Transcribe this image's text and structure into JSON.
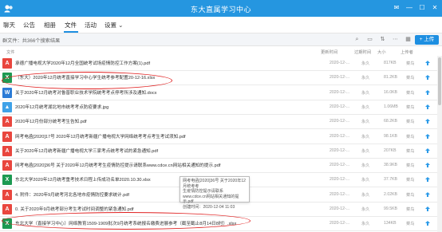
{
  "window": {
    "title": "东大直属学习中心",
    "controls": [
      "✉",
      "—",
      "☐",
      "✕"
    ]
  },
  "tabs": [
    {
      "label": "聊天"
    },
    {
      "label": "公告"
    },
    {
      "label": "相册"
    },
    {
      "label": "文件"
    },
    {
      "label": "活动"
    },
    {
      "label": "设置 ⌄"
    }
  ],
  "toolbar": {
    "breadcrumb": "群文件：共366个搜索结果",
    "upload_label": "+ 上传"
  },
  "columns": {
    "name": "文件",
    "updated": "更新时间",
    "expire": "过期时间",
    "size": "大小",
    "uploader": "上传者"
  },
  "files": [
    {
      "name": "承德广播电视大学2020年12月全国统考试场疫情防控工作方案(1).pdf",
      "type": "pdf",
      "updated": "2020-12-...",
      "expire": "永久",
      "size": "817KB",
      "uploader": "菜鸟"
    },
    {
      "name": "（东大）2020年12月统考直接学习中心学生统考参考配置20-12-16.xlsx",
      "type": "xlsx",
      "updated": "2020-12-...",
      "expire": "永久",
      "size": "81.2KB",
      "uploader": "菜鸟"
    },
    {
      "name": "关于2020年12月统考对鲁普职业技术学院统考考点停考所涉及通知.docx",
      "type": "docx",
      "updated": "2020-12-...",
      "expire": "永久",
      "size": "16.0KB",
      "uploader": "菜鸟"
    },
    {
      "name": "2020年12月统考湖北地市统考考点防疫要求.jpg",
      "type": "jpg",
      "updated": "2020-12-...",
      "expire": "永久",
      "size": "1.06MB",
      "uploader": "菜鸟"
    },
    {
      "name": "2020年12月份部分统考考生告知.pdf",
      "type": "pdf",
      "updated": "2020-12-...",
      "expire": "永久",
      "size": "68.2KB",
      "uploader": "菜鸟"
    },
    {
      "name": "网考电函[2020]17号 2020年12月统考新疆广播电视大学网络统考考点考生考试须知.pdf",
      "type": "pdf",
      "updated": "2020-12-...",
      "expire": "永久",
      "size": "98.1KB",
      "uploader": "菜鸟"
    },
    {
      "name": "关于2020年12月统考新疆广播电视大学三家考点统考考试的紧急通知.pdf",
      "type": "pdf",
      "updated": "2020-12-...",
      "expire": "永久",
      "size": "207KB",
      "uploader": "菜鸟"
    },
    {
      "name": "网考电函[2020]36号 关于2020年12月统考考生疫情防控提示请联系www.cdce.cn网站相关通知的提示.pdf",
      "type": "pdf",
      "updated": "2020-12-...",
      "expire": "永久",
      "size": "38.9KB",
      "uploader": "菜鸟"
    },
    {
      "name": "东北大学2020年12月统考重考技术日程上传成功名单2020.10.30.xlsx",
      "type": "xlsx",
      "updated": "2020-12-...",
      "expire": "永久",
      "size": "37.7KB",
      "uploader": "菜鸟"
    },
    {
      "name": "4. 附件：2020年9月统考河北各地市疫情防控要求统计.pdf",
      "type": "pdf",
      "updated": "2020-12-...",
      "expire": "永久",
      "size": "2.02KB",
      "uploader": "菜鸟"
    },
    {
      "name": "0. 关于2020年9月统考部分考生考试时间调整的紧急通知.pdf",
      "type": "pdf",
      "updated": "2020-12-...",
      "expire": "永久",
      "size": "99.5KB",
      "uploader": "菜鸟"
    },
    {
      "name": "东北大学（直接学习中心）网络教育1509-1909批次9月统考系统报名缴费进展参考（截至截止8月14日8时）.xlsx",
      "type": "xlsx",
      "updated": "2020-12-...",
      "expire": "永久",
      "size": "134KB",
      "uploader": "菜鸟"
    }
  ],
  "tooltip": {
    "line1": "网考电函[2020]36号 关于2020年12月统考考",
    "line2": "生疫情防控提示请联系www.cdce.cn网站相关通知的提",
    "line3": "示.pdf",
    "line4": "创建时间：2020-12-04 11:03"
  },
  "icons": {
    "titlebar_app": "group-chat-icon",
    "upload_row": "upload-arrow-icon",
    "pdf": "pdf-file-icon",
    "xlsx": "excel-file-icon",
    "docx": "word-file-icon",
    "jpg": "image-file-icon"
  },
  "colors": {
    "titlebar": "#2596e0",
    "accent": "#1e8fe1",
    "highlight_ellipse": "#e02020"
  }
}
